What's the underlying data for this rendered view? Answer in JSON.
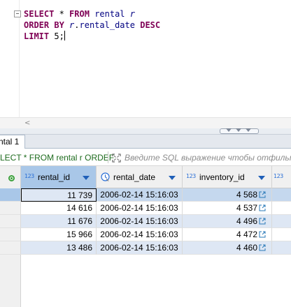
{
  "editor": {
    "lines": [
      [
        {
          "t": "SELECT",
          "c": "kw"
        },
        {
          "t": " * ",
          "c": "sym"
        },
        {
          "t": "FROM",
          "c": "kw"
        },
        {
          "t": " ",
          "c": "sym"
        },
        {
          "t": "rental",
          "c": "ident"
        },
        {
          "t": " ",
          "c": "sym"
        },
        {
          "t": "r",
          "c": "alias"
        }
      ],
      [
        {
          "t": "ORDER BY",
          "c": "kw"
        },
        {
          "t": " ",
          "c": "sym"
        },
        {
          "t": "r",
          "c": "alias"
        },
        {
          "t": ".",
          "c": "sym"
        },
        {
          "t": "rental_date",
          "c": "ident"
        },
        {
          "t": " ",
          "c": "sym"
        },
        {
          "t": "DESC",
          "c": "kw"
        }
      ],
      [
        {
          "t": "LIMIT",
          "c": "kw"
        },
        {
          "t": " ",
          "c": "sym"
        },
        {
          "t": "5",
          "c": "num"
        },
        {
          "t": ";",
          "c": "sym"
        }
      ]
    ],
    "scroll_left_glyph": "<"
  },
  "results": {
    "tab_label": "ntal 1",
    "filter_query": "ELECT * FROM rental r ORDEF",
    "filter_placeholder": "Введите SQL выражение чтобы отфильтровать",
    "columns": [
      {
        "name": "rental_id",
        "type_badge": "123",
        "type_icon": "numeric-type-icon"
      },
      {
        "name": "rental_date",
        "type_icon": "datetime-type-icon"
      },
      {
        "name": "inventory_id",
        "type_badge": "123",
        "type_icon": "numeric-type-icon"
      },
      {
        "name": "",
        "type_badge": "123",
        "type_icon": "numeric-type-icon"
      }
    ],
    "rows": [
      {
        "rental_id": "11 739",
        "rental_date": "2006-02-14 15:16:03",
        "inventory_id": "4 568"
      },
      {
        "rental_id": "14 616",
        "rental_date": "2006-02-14 15:16:03",
        "inventory_id": "4 537"
      },
      {
        "rental_id": "11 676",
        "rental_date": "2006-02-14 15:16:03",
        "inventory_id": "4 496"
      },
      {
        "rental_id": "15 966",
        "rental_date": "2006-02-14 15:16:03",
        "inventory_id": "4 472"
      },
      {
        "rental_id": "13 486",
        "rental_date": "2006-02-14 15:16:03",
        "inventory_id": "4 460"
      }
    ],
    "selected_row_index": 0
  },
  "colors": {
    "keyword": "#7f0055",
    "identifier": "#000080",
    "selected_header": "#a9c7e8",
    "alt_row": "#dee7f4",
    "filter_text": "#1d6b1d"
  }
}
